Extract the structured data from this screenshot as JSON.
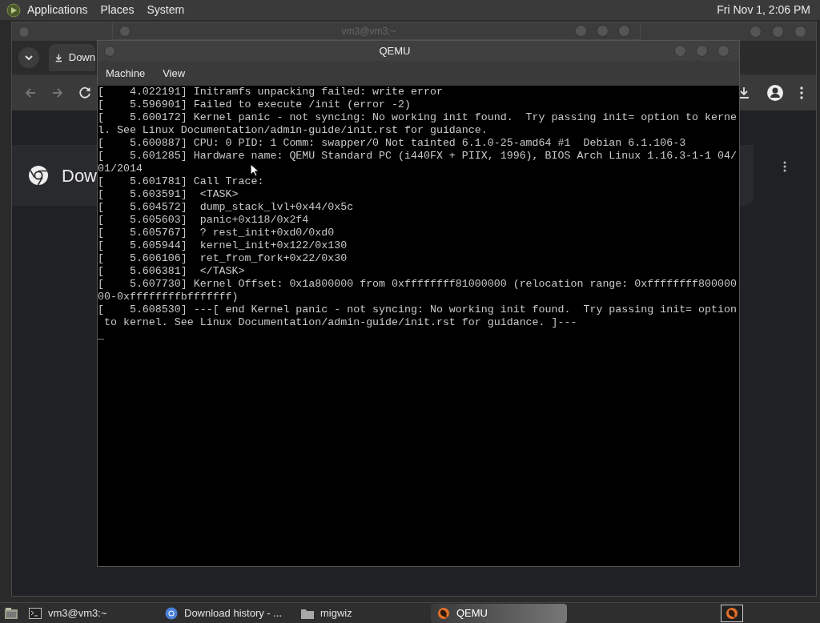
{
  "top_panel": {
    "menus": [
      "Applications",
      "Places",
      "System"
    ],
    "clock": "Fri Nov 1, 2:06 PM"
  },
  "terminal_window": {
    "title": "vm3@vm3:~"
  },
  "browser_window": {
    "tab_title": "Down",
    "page_heading": "Dow"
  },
  "qemu_window": {
    "title": "QEMU",
    "menus": [
      "Machine",
      "View"
    ],
    "console_lines": [
      "[    4.022191] Initramfs unpacking failed: write error",
      "[    5.596901] Failed to execute /init (error -2)",
      "[    5.600172] Kernel panic - not syncing: No working init found.  Try passing init= option to kerne",
      "l. See Linux Documentation/admin-guide/init.rst for guidance.",
      "[    5.600887] CPU: 0 PID: 1 Comm: swapper/0 Not tainted 6.1.0-25-amd64 #1  Debian 6.1.106-3",
      "[    5.601285] Hardware name: QEMU Standard PC (i440FX + PIIX, 1996), BIOS Arch Linux 1.16.3-1-1 04/",
      "01/2014",
      "[    5.601781] Call Trace:",
      "[    5.603591]  <TASK>",
      "[    5.604572]  dump_stack_lvl+0x44/0x5c",
      "[    5.605603]  panic+0x118/0x2f4",
      "[    5.605767]  ? rest_init+0xd0/0xd0",
      "[    5.605944]  kernel_init+0x122/0x130",
      "[    5.606106]  ret_from_fork+0x22/0x30",
      "[    5.606381]  </TASK>",
      "[    5.607730] Kernel Offset: 0x1a800000 from 0xffffffff81000000 (relocation range: 0xffffffff800000",
      "00-0xffffffffbfffffff)",
      "[    5.608530] ---[ end Kernel panic - not syncing: No working init found.  Try passing init= option",
      " to kernel. See Linux Documentation/admin-guide/init.rst for guidance. ]---"
    ],
    "cursor": "_"
  },
  "taskbar": {
    "tasks": [
      {
        "label": "vm3@vm3:~",
        "kind": "terminal",
        "selected": false
      },
      {
        "label": "Download history - ...",
        "kind": "browser",
        "selected": false
      },
      {
        "label": "migwiz",
        "kind": "folder",
        "selected": false
      },
      {
        "label": "QEMU",
        "kind": "qemu",
        "selected": true
      }
    ]
  }
}
